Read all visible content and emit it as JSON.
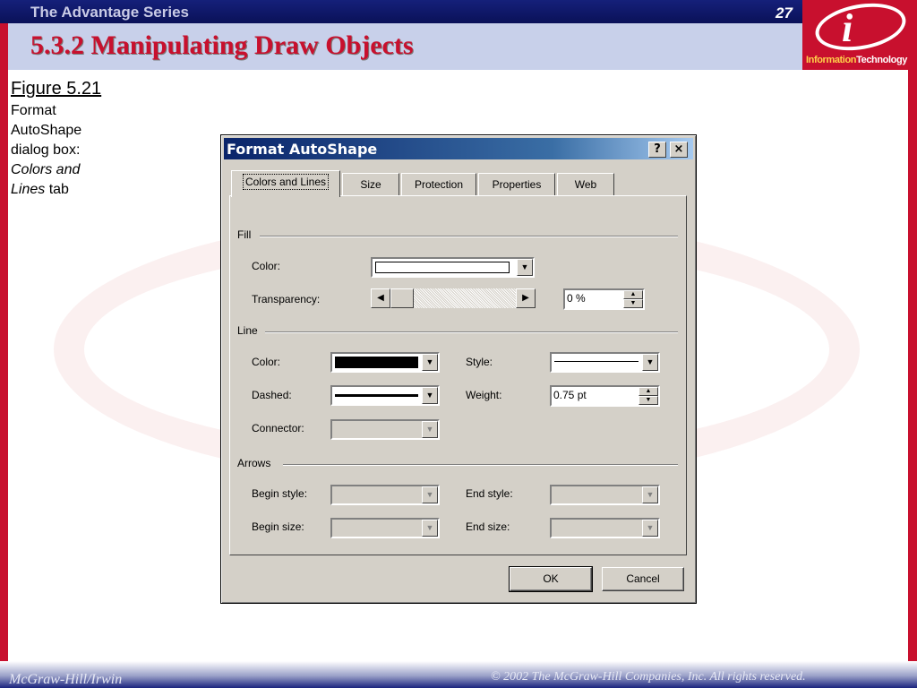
{
  "slide": {
    "series": "The Advantage Series",
    "page_number": "27",
    "title": "5.3.2 Manipulating Draw Objects",
    "logo": {
      "letter": "i",
      "word1": "Information",
      "word2": "Technology"
    },
    "footer_left": "McGraw-Hill/Irwin",
    "footer_right": "© 2002 The McGraw-Hill Companies, Inc. All rights reserved."
  },
  "caption": {
    "figure": "Figure 5.21",
    "line1": "Format",
    "line2": "AutoShape",
    "line3": "dialog box:",
    "line4_italic": "Colors and",
    "line5_italic": "Lines",
    "line5_rest": " tab"
  },
  "dialog": {
    "title": "Format AutoShape",
    "help_button": "?",
    "close_button": "×",
    "tabs": [
      {
        "label": "Colors and Lines",
        "active": true
      },
      {
        "label": "Size"
      },
      {
        "label": "Protection"
      },
      {
        "label": "Properties"
      },
      {
        "label": "Web"
      }
    ],
    "fill": {
      "group": "Fill",
      "color_label": "Color:",
      "color_value": "#ffffff",
      "transparency_label": "Transparency:",
      "transparency_value": "0 %",
      "transparency_percent": 0
    },
    "line": {
      "group": "Line",
      "color_label": "Color:",
      "color_value": "#000000",
      "style_label": "Style:",
      "dashed_label": "Dashed:",
      "weight_label": "Weight:",
      "weight_value": "0.75 pt",
      "connector_label": "Connector:"
    },
    "arrows": {
      "group": "Arrows",
      "begin_style_label": "Begin style:",
      "end_style_label": "End style:",
      "begin_size_label": "Begin size:",
      "end_size_label": "End size:"
    },
    "ok_label": "OK",
    "cancel_label": "Cancel"
  },
  "colors": {
    "accent_red": "#c8102e",
    "navy": "#0a1158",
    "dialog_face": "#d4d0c8"
  }
}
